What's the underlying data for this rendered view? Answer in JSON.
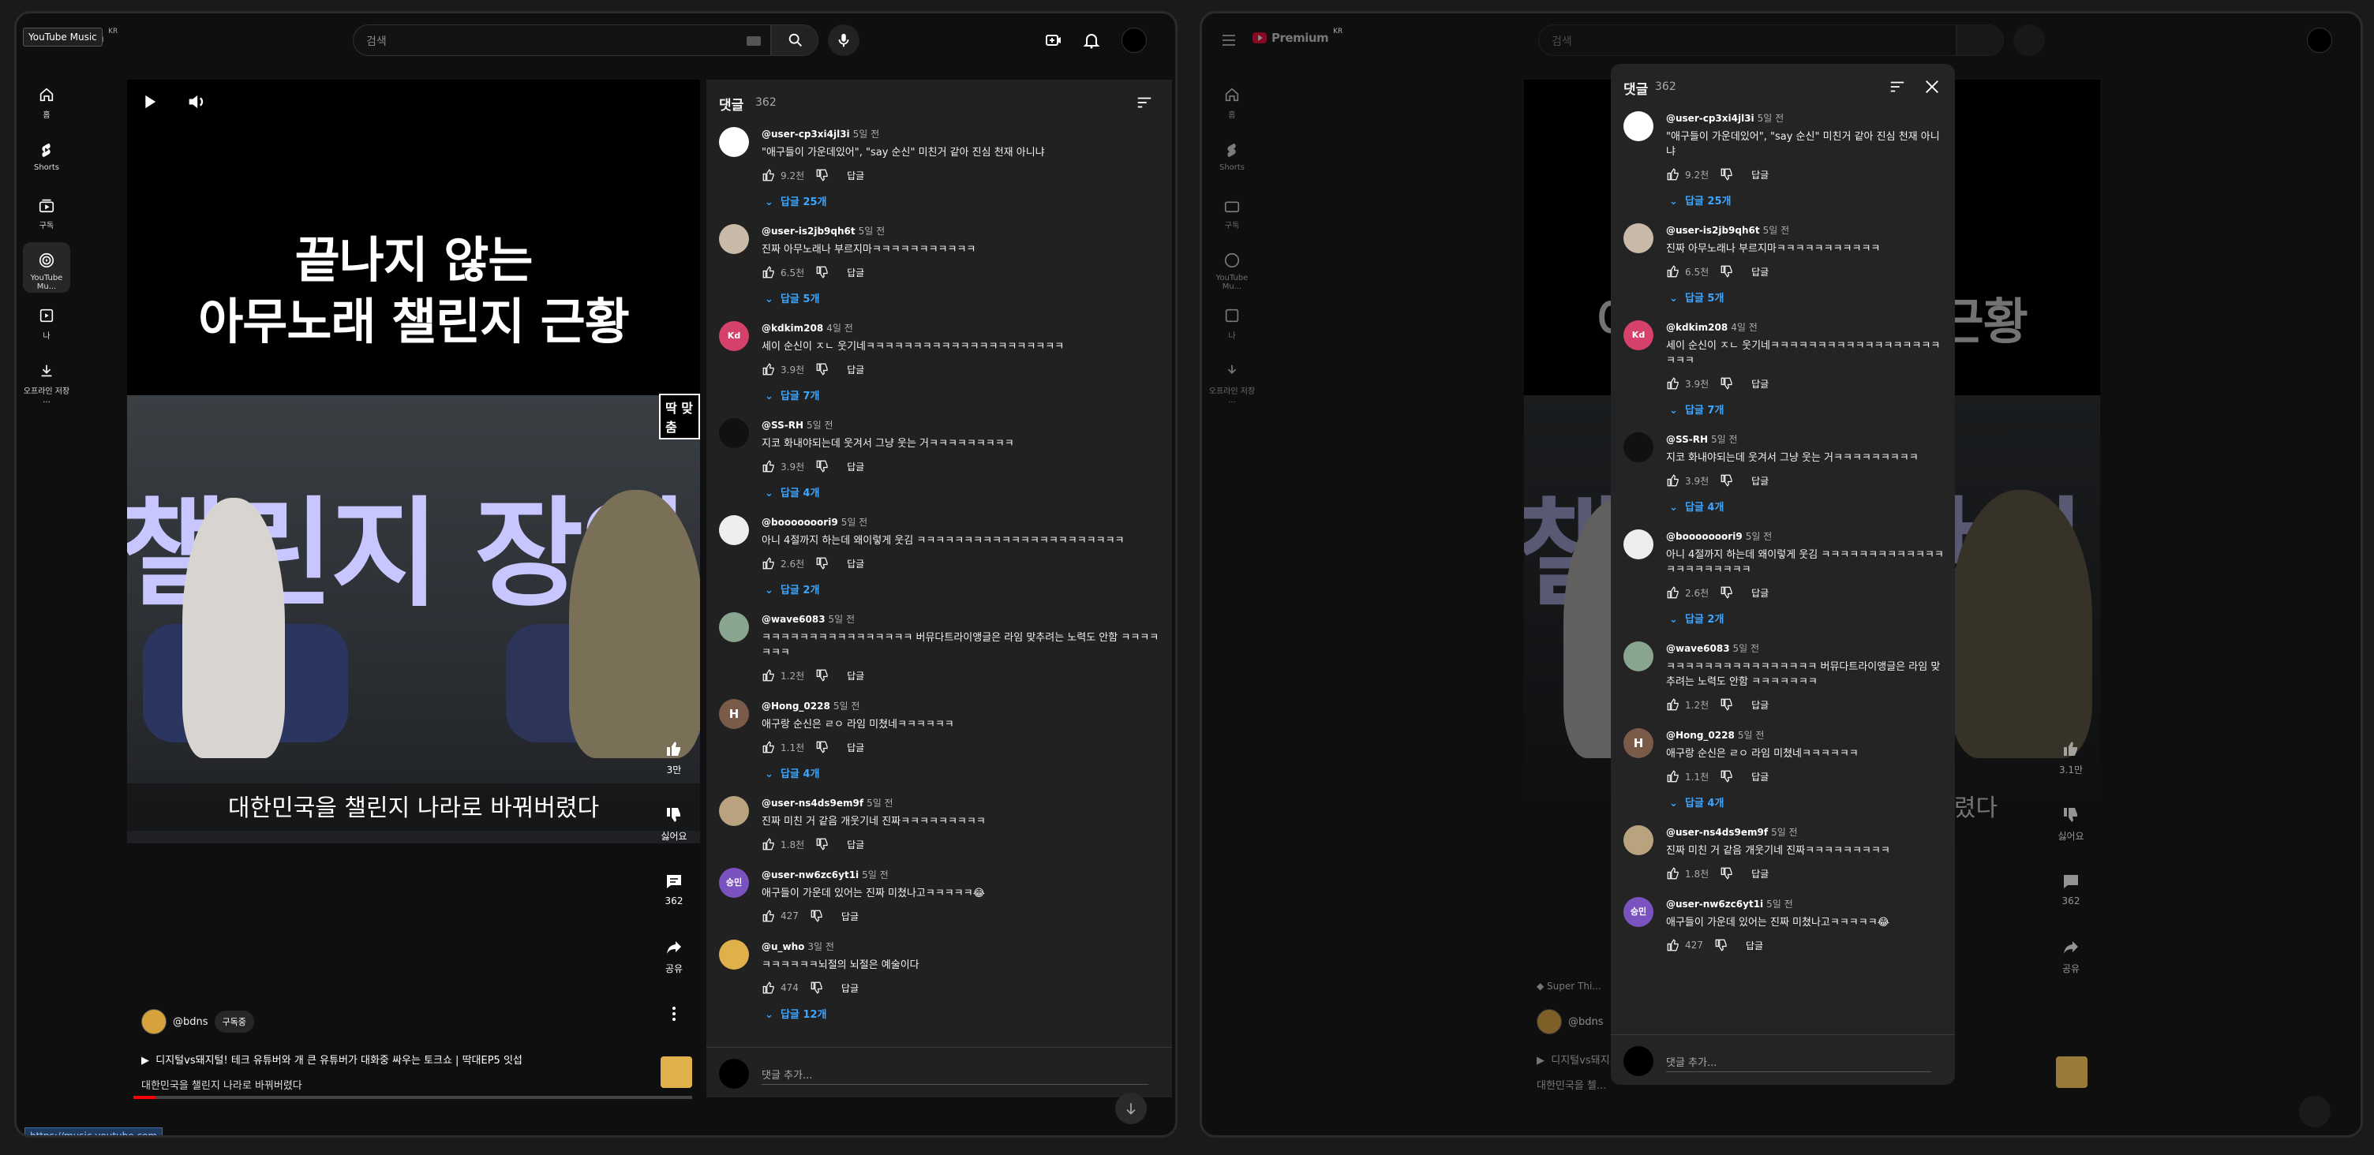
{
  "topbar": {
    "brand": "Premium",
    "brand_region": "KR",
    "tooltip": "YouTube Music",
    "search_placeholder": "검색"
  },
  "sidebar": [
    {
      "label": "홈",
      "icon": "home-icon"
    },
    {
      "label": "Shorts",
      "icon": "shorts-icon"
    },
    {
      "label": "구독",
      "icon": "subscriptions-icon"
    },
    {
      "label": "YouTube Mu...",
      "icon": "youtube-music-icon"
    },
    {
      "label": "나",
      "icon": "you-icon"
    },
    {
      "label": "오프라인 저장 ...",
      "icon": "download-icon"
    }
  ],
  "sidebar_right": [
    {
      "label": "홈",
      "icon": "home-icon"
    },
    {
      "label": "Shorts",
      "icon": "shorts-icon"
    },
    {
      "label": "구독",
      "icon": "subscriptions-icon"
    },
    {
      "label": "YouTube Mu...",
      "icon": "youtube-music-icon"
    },
    {
      "label": "나",
      "icon": "you-icon"
    },
    {
      "label": "오프라인 저장 ...",
      "icon": "download-icon"
    }
  ],
  "video": {
    "overlay_title_line1": "끝나지 않는",
    "overlay_title_line2": "아무노래 챌린지 근황",
    "tag": "딱 맞춤",
    "big_text": "챌린지 장인",
    "subtitle": "대한민국을 챌린지 나라로 바꿔버렸다",
    "likes": "3만",
    "dislike_label": "싫어요",
    "comments_count": "362",
    "share_label": "공유",
    "progress_fraction": 0.04,
    "channel": "@bdns",
    "subscribe": "구독중",
    "title": "디지털vs돼지털! 테크 유튜버와 개 큰 유튜버가 대화중 싸우는 토크쇼 | 딱대EP5 잇섭",
    "description": "대한민국을 챌린지 나라로 바꿔버렸다"
  },
  "video_right": {
    "likes": "3.1만",
    "dislike_label": "싫어요",
    "comments_count": "362",
    "share_label": "공유",
    "channel": "@bdns",
    "title": "디지털vs돼지...",
    "description": "대한민국을 첼...",
    "promo": "Super Thi..."
  },
  "status_url": "https://music.youtube.com",
  "comments": {
    "title": "댓글",
    "count": "362",
    "add_placeholder": "댓글 추가...",
    "reply_label": "답글",
    "items": [
      {
        "user": "@user-cp3xi4jl3i",
        "ago": "5일 전",
        "text": "\"애구들이 가운데있어\", \"say 순신\" 미친거 같아 진심 천재 아니냐",
        "likes": "9.2천",
        "replies": "답글 25개",
        "avatar_color": "#ffffff",
        "initial": ""
      },
      {
        "user": "@user-is2jb9qh6t",
        "ago": "5일 전",
        "text": "진짜 아무노래나 부르지마ㅋㅋㅋㅋㅋㅋㅋㅋㅋㅋㅋ",
        "likes": "6.5천",
        "replies": "답글 5개",
        "avatar_color": "#c9b9a8",
        "initial": ""
      },
      {
        "user": "@kdkim208",
        "ago": "4일 전",
        "text": "세이 순신이 ㅈㄴ 웃기네ㅋㅋㅋㅋㅋㅋㅋㅋㅋㅋㅋㅋㅋㅋㅋㅋㅋㅋㅋㅋㅋ",
        "likes": "3.9천",
        "replies": "답글 7개",
        "avatar_color": "#d6416b",
        "initial": "Kd"
      },
      {
        "user": "@SS-RH",
        "ago": "5일 전",
        "text": "지코 화내야되는데 웃겨서 그냥 웃는 거ㅋㅋㅋㅋㅋㅋㅋㅋㅋ",
        "likes": "3.9천",
        "replies": "답글 4개",
        "avatar_color": "#111111",
        "initial": ""
      },
      {
        "user": "@booooooori9",
        "ago": "5일 전",
        "text": "아니 4절까지 하는데 왜이렇게 웃김 ㅋㅋㅋㅋㅋㅋㅋㅋㅋㅋㅋㅋㅋㅋㅋㅋㅋㅋㅋㅋㅋㅋ",
        "likes": "2.6천",
        "replies": "답글 2개",
        "avatar_color": "#eeeeee",
        "initial": ""
      },
      {
        "user": "@wave6083",
        "ago": "5일 전",
        "text": "ㅋㅋㅋㅋㅋㅋㅋㅋㅋㅋㅋㅋㅋㅋㅋㅋ 버뮤다트라이앵글은 라임 맞추려는 노력도 안함 ㅋㅋㅋㅋㅋㅋㅋ",
        "likes": "1.2천",
        "replies": "",
        "avatar_color": "#8aa58f",
        "initial": ""
      },
      {
        "user": "@Hong_0228",
        "ago": "5일 전",
        "text": "애구랑 순신은 ㄹㅇ 라임 미쳤네ㅋㅋㅋㅋㅋㅋ",
        "likes": "1.1천",
        "replies": "답글 4개",
        "avatar_color": "#7a5a48",
        "initial": "H"
      },
      {
        "user": "@user-ns4ds9em9f",
        "ago": "5일 전",
        "text": "진짜 미친 거 같음 개웃기네 진짜ㅋㅋㅋㅋㅋㅋㅋㅋㅋ",
        "likes": "1.8천",
        "replies": "",
        "avatar_color": "#b9a27e",
        "initial": ""
      },
      {
        "user": "@user-nw6zc6yt1i",
        "ago": "5일 전",
        "text": "애구들이 가운데 있어는 진짜 미쳤나고ㅋㅋㅋㅋㅋ😂",
        "likes": "427",
        "replies": "",
        "avatar_color": "#7a53c1",
        "initial": "승민"
      },
      {
        "user": "@u_who",
        "ago": "3일 전",
        "text": "ㅋㅋㅋㅋㅋㅋ뇌절의 뇌절은 예술이다",
        "likes": "474",
        "replies": "답글 12개",
        "avatar_color": "#e0b04a",
        "initial": ""
      }
    ]
  },
  "colors": {
    "accent": "#3ea6ff",
    "brand": "#ff0033",
    "panel": "#212121",
    "bg": "#0f0f0f"
  }
}
